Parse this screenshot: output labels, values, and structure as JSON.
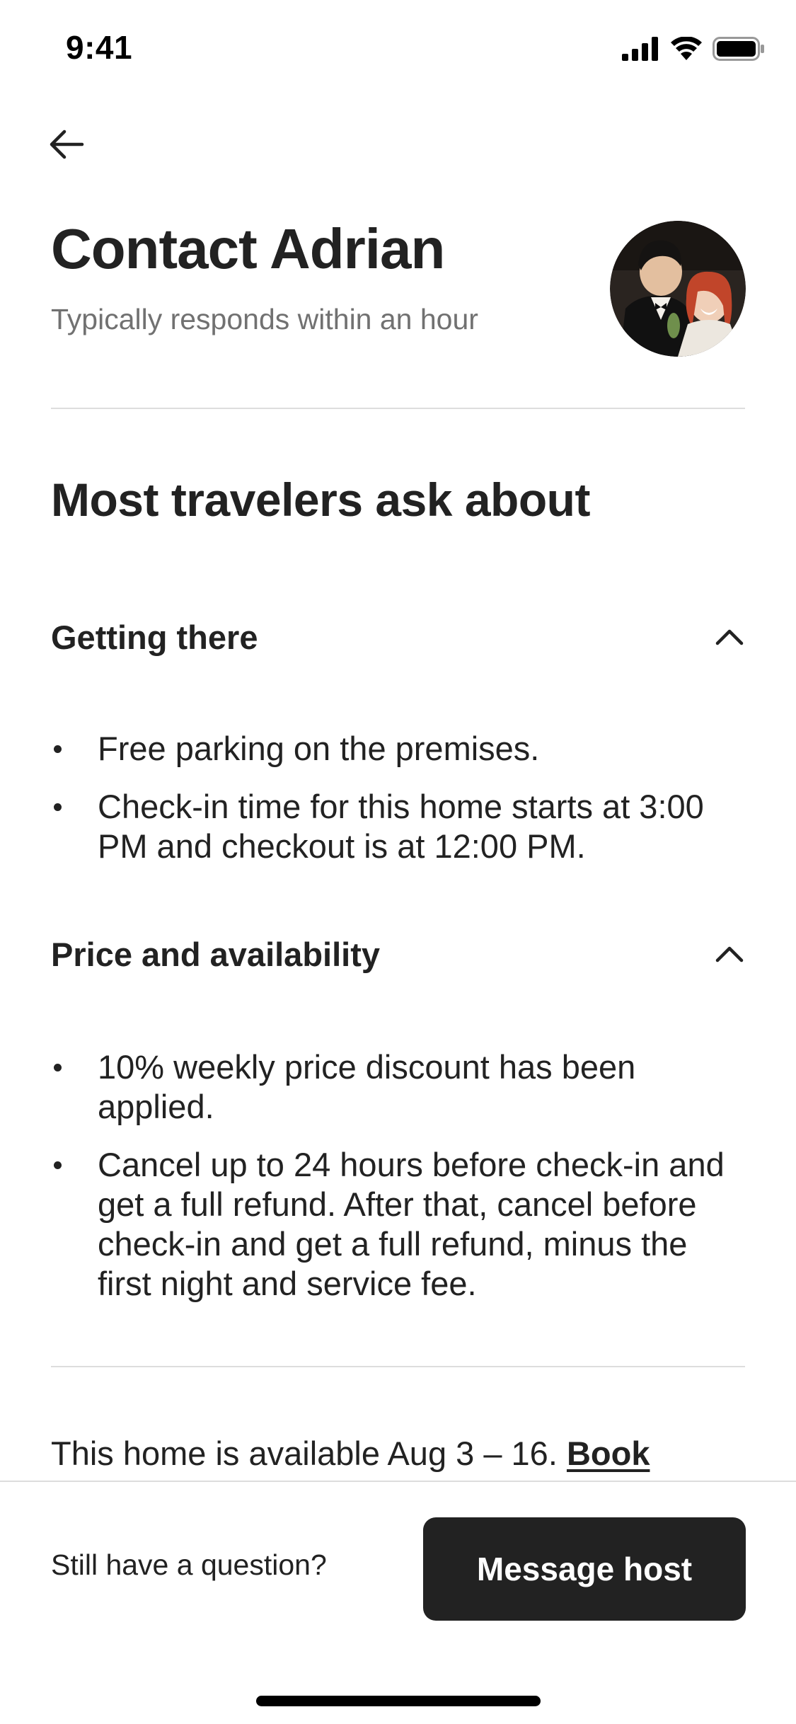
{
  "status_bar": {
    "time": "9:41",
    "icons": [
      "cellular-signal-icon",
      "wifi-icon",
      "battery-icon"
    ]
  },
  "header": {
    "back_icon": "arrow-left-icon",
    "title": "Contact Adrian",
    "subtitle": "Typically responds within an hour",
    "avatar_icon": "host-avatar-photo"
  },
  "faq": {
    "heading": "Most travelers ask about",
    "sections": [
      {
        "title": "Getting there",
        "expanded": true,
        "chevron_icon": "chevron-up-icon",
        "items": [
          "Free parking on the premises.",
          "Check-in time for this home starts at 3:00 PM and checkout is at 12:00 PM."
        ]
      },
      {
        "title": "Price and availability",
        "expanded": true,
        "chevron_icon": "chevron-up-icon",
        "items": [
          "10% weekly price discount has been applied.",
          "Cancel up to 24 hours before check-in and get a full refund. After that, cancel before check-in and get a full refund, minus the first night and service fee."
        ]
      }
    ]
  },
  "availability": {
    "text": "This home is available Aug 3 – 16.",
    "link_label": "Book"
  },
  "footer": {
    "question": "Still have a question?",
    "button_label": "Message host"
  },
  "colors": {
    "text_primary": "#222222",
    "text_secondary": "#717171",
    "divider": "#dddddd",
    "button_bg": "#222222",
    "button_text": "#ffffff"
  }
}
